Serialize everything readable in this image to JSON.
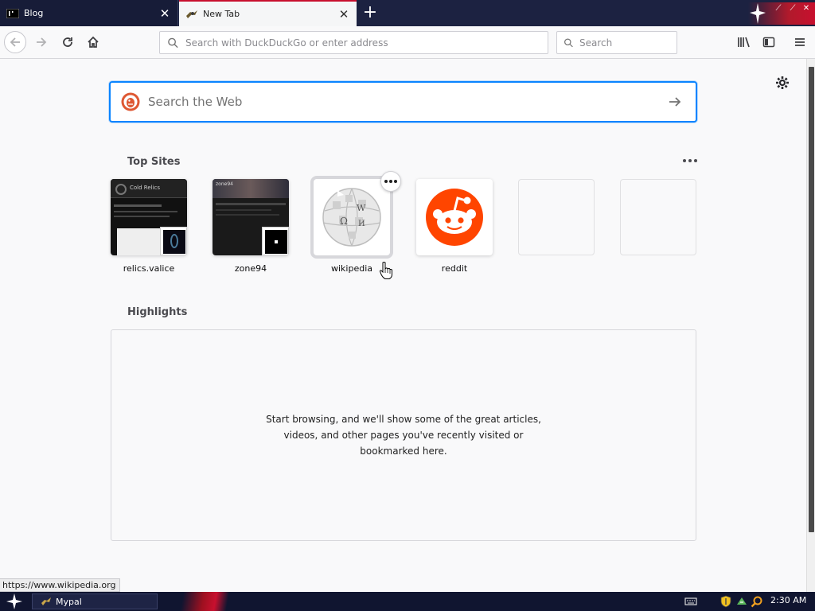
{
  "tabs": [
    {
      "label": "Blog"
    },
    {
      "label": "New Tab"
    }
  ],
  "navbar": {
    "url_placeholder": "Search with DuckDuckGo or enter address",
    "search_placeholder": "Search"
  },
  "newtab": {
    "search_placeholder": "Search the Web",
    "top_sites_title": "Top Sites",
    "top_sites": [
      {
        "label": "relics.valice",
        "tile_title": "Cold Relics"
      },
      {
        "label": "zone94",
        "tile_title": "zone94"
      },
      {
        "label": "wikipedia"
      },
      {
        "label": "reddit"
      },
      {
        "label": ""
      },
      {
        "label": ""
      }
    ],
    "highlights_title": "Highlights",
    "highlights_empty": "Start browsing, and we'll show some of the great articles, videos, and other pages you've recently visited or bookmarked here."
  },
  "status_link": "https://www.wikipedia.org",
  "taskbar": {
    "task_label": "Mypal",
    "clock": "2:30 AM"
  },
  "colors": {
    "accent": "#0a84ff",
    "reddit": "#ff4500",
    "tab_highlight": "#c8102e"
  },
  "icons": [
    "back-icon",
    "forward-icon",
    "reload-icon",
    "home-icon",
    "search-icon",
    "library-icon",
    "sidebar-icon",
    "menu-icon",
    "gear-icon",
    "duckduckgo-icon",
    "arrow-right-icon",
    "more-icon",
    "close-icon",
    "plus-icon",
    "star-icon",
    "shield-icon",
    "cursor-hand-icon",
    "keyboard-icon"
  ]
}
